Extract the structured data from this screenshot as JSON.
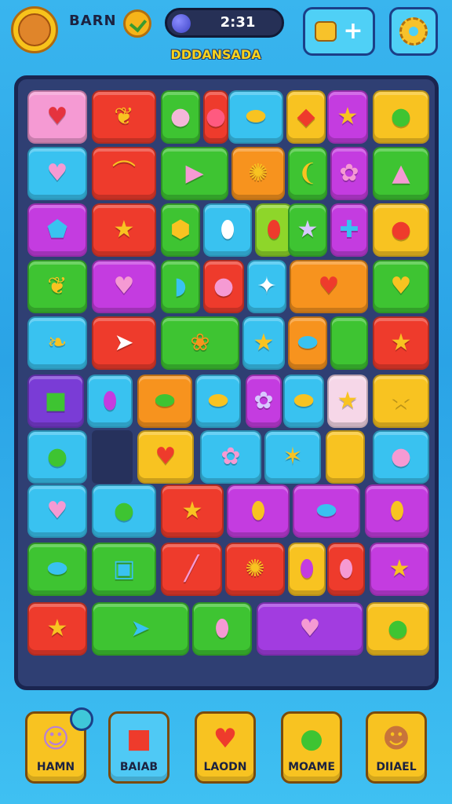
{
  "hud": {
    "player_name": "BARN",
    "timer": "2:31",
    "subtitle": "DDDANSADA"
  },
  "icons": {
    "avatar": "player-avatar",
    "coin": "checkmark-coin-icon",
    "timer_orb": "orb-icon",
    "shop": "box-icon",
    "add": "plus-icon",
    "settings": "gear-icon"
  },
  "board": {
    "tiles": [
      {
        "color": "#f59ad3",
        "glyph": "♥",
        "gcolor": "#e5333f"
      },
      {
        "color": "#ee3b2c",
        "glyph": "❦",
        "gcolor": "#f8c321"
      },
      {
        "color": "#3ec432",
        "glyph": "●",
        "gcolor": "#f3b7d8"
      },
      {
        "color": "#ee3b2c",
        "glyph": "●",
        "gcolor": "#ff5a80"
      },
      {
        "color": "#39c2f0",
        "glyph": "⬬",
        "gcolor": "#f8c321"
      },
      {
        "color": "#f8c321",
        "glyph": "◆",
        "gcolor": "#ee3b2c"
      },
      {
        "color": "#c43ce0",
        "glyph": "★",
        "gcolor": "#f8c321"
      },
      {
        "color": "#f8c321",
        "glyph": "●",
        "gcolor": "#3ec432"
      },
      {
        "color": "#39c2f0",
        "glyph": "♥",
        "gcolor": "#f59ad3"
      },
      {
        "color": "#ee3b2c",
        "glyph": "⌒",
        "gcolor": "#f8c321"
      },
      {
        "color": "#3ec432",
        "glyph": "▶",
        "gcolor": "#f59ad3"
      },
      {
        "color": "#f7931e",
        "glyph": "✺",
        "gcolor": "#f8c321"
      },
      {
        "color": "#3ec432",
        "glyph": "❨",
        "gcolor": "#f8c321"
      },
      {
        "color": "#c43ce0",
        "glyph": "✿",
        "gcolor": "#f59ad3"
      },
      {
        "color": "#3ec432",
        "glyph": "▲",
        "gcolor": "#f59ad3"
      },
      {
        "color": "#c43ce0",
        "glyph": "⬟",
        "gcolor": "#39c2f0"
      },
      {
        "color": "#ee3b2c",
        "glyph": "★",
        "gcolor": "#f8c321"
      },
      {
        "color": "#3ec432",
        "glyph": "⬢",
        "gcolor": "#f8c321"
      },
      {
        "color": "#39c2f0",
        "glyph": "⬮",
        "gcolor": "#ffffff"
      },
      {
        "color": "#8ed62a",
        "glyph": "⬮",
        "gcolor": "#ee3b2c"
      },
      {
        "color": "#3ec432",
        "glyph": "★",
        "gcolor": "#d8c8ff"
      },
      {
        "color": "#c43ce0",
        "glyph": "✚",
        "gcolor": "#39c2f0"
      },
      {
        "color": "#f8c321",
        "glyph": "●",
        "gcolor": "#ee3b2c"
      },
      {
        "color": "#3ec432",
        "glyph": "❦",
        "gcolor": "#f8c321"
      },
      {
        "color": "#c43ce0",
        "glyph": "♥",
        "gcolor": "#f59ad3"
      },
      {
        "color": "#3ec432",
        "glyph": "◗",
        "gcolor": "#39c2f0"
      },
      {
        "color": "#ee3b2c",
        "glyph": "●",
        "gcolor": "#f59ad3"
      },
      {
        "color": "#39c2f0",
        "glyph": "✦",
        "gcolor": "#ffffff"
      },
      {
        "color": "#f7931e",
        "glyph": "♥",
        "gcolor": "#ee3b2c"
      },
      {
        "color": "#3ec432",
        "glyph": "♥",
        "gcolor": "#f8c321"
      },
      {
        "color": "#39c2f0",
        "glyph": "❧",
        "gcolor": "#f8c321"
      },
      {
        "color": "#ee3b2c",
        "glyph": "➤",
        "gcolor": "#ffffff"
      },
      {
        "color": "#3ec432",
        "glyph": "❀",
        "gcolor": "#f7931e"
      },
      {
        "color": "#39c2f0",
        "glyph": "★",
        "gcolor": "#f8c321"
      },
      {
        "color": "#f7931e",
        "glyph": "⬬",
        "gcolor": "#39c2f0"
      },
      {
        "color": "#3ec432",
        "glyph": "",
        "gcolor": "#3ec432"
      },
      {
        "color": "#ee3b2c",
        "glyph": "★",
        "gcolor": "#f8c321"
      },
      {
        "color": "#7a3cd6",
        "glyph": "■",
        "gcolor": "#3ec432"
      },
      {
        "color": "#39c2f0",
        "glyph": "⬮",
        "gcolor": "#c43ce0"
      },
      {
        "color": "#f7931e",
        "glyph": "⬬",
        "gcolor": "#3ec432"
      },
      {
        "color": "#39c2f0",
        "glyph": "⬬",
        "gcolor": "#f8c321"
      },
      {
        "color": "#c43ce0",
        "glyph": "✿",
        "gcolor": "#d8c8ff"
      },
      {
        "color": "#39c2f0",
        "glyph": "⬬",
        "gcolor": "#f8c321"
      },
      {
        "color": "#f6d7e8",
        "glyph": "★",
        "gcolor": "#f8c321"
      },
      {
        "color": "#f8c321",
        "glyph": "★",
        "gcolor": "#f8c321"
      },
      {
        "color": "#39c2f0",
        "glyph": "●",
        "gcolor": "#3ec432"
      },
      {
        "color": "#f8c321",
        "glyph": "♥",
        "gcolor": "#ee3b2c"
      },
      {
        "color": "#39c2f0",
        "glyph": "✿",
        "gcolor": "#f59ad3"
      },
      {
        "color": "#39c2f0",
        "glyph": "✶",
        "gcolor": "#f8c321"
      },
      {
        "color": "#f8c321",
        "glyph": "",
        "gcolor": "#f8c321"
      },
      {
        "color": "#39c2f0",
        "glyph": "●",
        "gcolor": "#f59ad3"
      },
      {
        "color": "#39c2f0",
        "glyph": "♥",
        "gcolor": "#f59ad3"
      },
      {
        "color": "#39c2f0",
        "glyph": "●",
        "gcolor": "#3ec432"
      },
      {
        "color": "#ee3b2c",
        "glyph": "★",
        "gcolor": "#f8c321"
      },
      {
        "color": "#c43ce0",
        "glyph": "⬮",
        "gcolor": "#f8c321"
      },
      {
        "color": "#c43ce0",
        "glyph": "⬬",
        "gcolor": "#39c2f0"
      },
      {
        "color": "#c43ce0",
        "glyph": "⬮",
        "gcolor": "#f8c321"
      },
      {
        "color": "#3ec432",
        "glyph": "⬬",
        "gcolor": "#39c2f0"
      },
      {
        "color": "#3ec432",
        "glyph": "▣",
        "gcolor": "#39c2f0"
      },
      {
        "color": "#ee3b2c",
        "glyph": "╱",
        "gcolor": "#f59ad3"
      },
      {
        "color": "#ee3b2c",
        "glyph": "✺",
        "gcolor": "#f8c321"
      },
      {
        "color": "#f8c321",
        "glyph": "⬮",
        "gcolor": "#c43ce0"
      },
      {
        "color": "#ee3b2c",
        "glyph": "⬮",
        "gcolor": "#f59ad3"
      },
      {
        "color": "#c43ce0",
        "glyph": "★",
        "gcolor": "#f8c321"
      },
      {
        "color": "#ee3b2c",
        "glyph": "★",
        "gcolor": "#f8c321"
      },
      {
        "color": "#3ec432",
        "glyph": "➤",
        "gcolor": "#39c2f0"
      },
      {
        "color": "#3ec432",
        "glyph": "⬮",
        "gcolor": "#f59ad3"
      },
      {
        "color": "#a23ce0",
        "glyph": "♥",
        "gcolor": "#f59ad3"
      },
      {
        "color": "#f8c321",
        "glyph": "●",
        "gcolor": "#3ec432"
      }
    ]
  },
  "bottom_bar": {
    "buttons": [
      {
        "label": "HAMN",
        "icon": "character-face-icon",
        "glyph": "☺",
        "gcolor": "#b87fd6"
      },
      {
        "label": "BAIAB",
        "icon": "red-box-icon",
        "glyph": "■",
        "gcolor": "#ee3b2c"
      },
      {
        "label": "LAODN",
        "icon": "heart-icon",
        "glyph": "♥",
        "gcolor": "#ee3b2c"
      },
      {
        "label": "MOAME",
        "icon": "green-bubble-icon",
        "glyph": "●",
        "gcolor": "#3ec432"
      },
      {
        "label": "DIIAEL",
        "icon": "boy-face-icon",
        "glyph": "☻",
        "gcolor": "#c8743a"
      }
    ]
  }
}
